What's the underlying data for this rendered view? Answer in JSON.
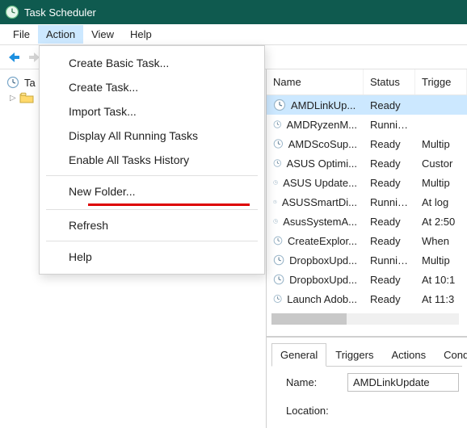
{
  "title": "Task Scheduler",
  "menubar": {
    "file": "File",
    "action": "Action",
    "view": "View",
    "help": "Help"
  },
  "tree": {
    "root": "Ta"
  },
  "columns": {
    "name": "Name",
    "status": "Status",
    "trigger": "Trigge"
  },
  "tasks": [
    {
      "name": "AMDLinkUp...",
      "status": "Ready",
      "trigger": ""
    },
    {
      "name": "AMDRyzenM...",
      "status": "Running",
      "trigger": ""
    },
    {
      "name": "AMDScoSup...",
      "status": "Ready",
      "trigger": "Multip"
    },
    {
      "name": "ASUS Optimi...",
      "status": "Ready",
      "trigger": "Custor"
    },
    {
      "name": "ASUS Update...",
      "status": "Ready",
      "trigger": "Multip"
    },
    {
      "name": "ASUSSmartDi...",
      "status": "Running",
      "trigger": "At log"
    },
    {
      "name": "AsusSystemA...",
      "status": "Ready",
      "trigger": "At 2:50"
    },
    {
      "name": "CreateExplor...",
      "status": "Ready",
      "trigger": "When"
    },
    {
      "name": "DropboxUpd...",
      "status": "Running",
      "trigger": "Multip"
    },
    {
      "name": "DropboxUpd...",
      "status": "Ready",
      "trigger": "At 10:1"
    },
    {
      "name": "Launch Adob...",
      "status": "Ready",
      "trigger": "At 11:3"
    }
  ],
  "details": {
    "tabs": {
      "general": "General",
      "triggers": "Triggers",
      "actions": "Actions",
      "conditions": "Condi"
    },
    "name_label": "Name:",
    "name_value": "AMDLinkUpdate",
    "location_label": "Location:",
    "location_value": ""
  },
  "action_menu": {
    "create_basic": "Create Basic Task...",
    "create_task": "Create Task...",
    "import_task": "Import Task...",
    "display_running": "Display All Running Tasks",
    "enable_history": "Enable All Tasks History",
    "new_folder": "New Folder...",
    "refresh": "Refresh",
    "help": "Help"
  }
}
